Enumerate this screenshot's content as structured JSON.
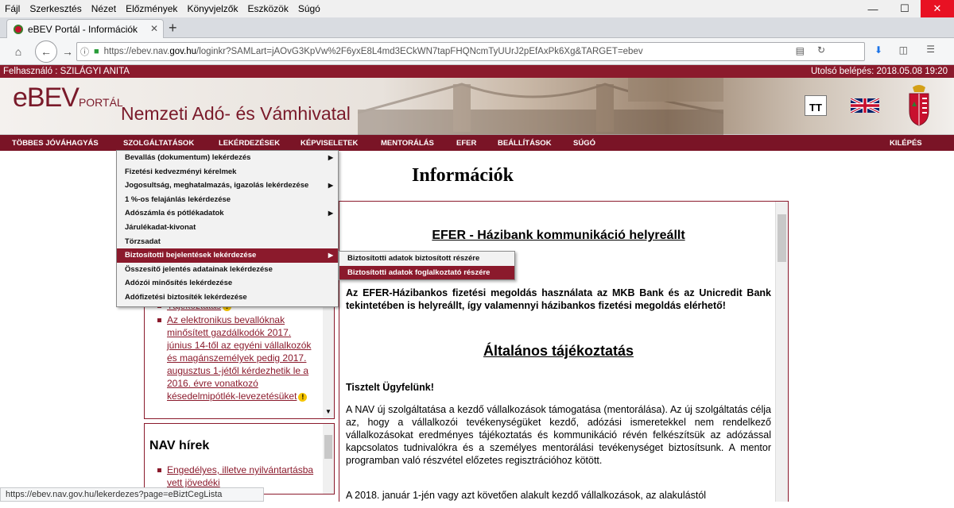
{
  "browser": {
    "menu": [
      "Fájl",
      "Szerkesztés",
      "Nézet",
      "Előzmények",
      "Könyvjelzők",
      "Eszközök",
      "Súgó"
    ],
    "tab_title": "eBEV Portál - Információk",
    "url_prefix": "https://ebev.nav.",
    "url_domain": "gov.hu",
    "url_rest": "/loginkr?SAMLart=jAOvG3KpVw%2F6yxE8L4md3ECkWN7tapFHQNcmTyUUrJ2pEfAxPk6Xg&TARGET=ebev",
    "status_url": "https://ebev.nav.gov.hu/lekerdezes?page=eBiztCegLista"
  },
  "header": {
    "user_label": "Felhasználó : SZILÁGYI ANITA",
    "last_login": "Utolsó belépés: 2018.05.08 19:20",
    "logo_main": "eBEV",
    "logo_small": "PORTÁL",
    "brand": "Nemzeti Adó- és Vámhivatal",
    "font_size_button": "TT"
  },
  "main_menu": [
    {
      "label": "TÖBBES JÓVÁHAGYÁS"
    },
    {
      "label": "SZOLGÁLTATÁSOK"
    },
    {
      "label": "LEKÉRDEZÉSEK"
    },
    {
      "label": "KÉPVISELETEK"
    },
    {
      "label": "MENTORÁLÁS"
    },
    {
      "label": "EFER"
    },
    {
      "label": "BEÁLLÍTÁSOK"
    },
    {
      "label": "SÚGÓ"
    },
    {
      "label": "KILÉPÉS"
    }
  ],
  "dropdown": {
    "items": [
      {
        "label": "Bevallás (dokumentum) lekérdezés",
        "has_sub": true
      },
      {
        "label": "Fizetési kedvezményi kérelmek",
        "has_sub": false
      },
      {
        "label": "Jogosultság, meghatalmazás, igazolás lekérdezése",
        "has_sub": true
      },
      {
        "label": "1 %-os felajánlás lekérdezése",
        "has_sub": false
      },
      {
        "label": "Adószámla és pótlékadatok",
        "has_sub": true
      },
      {
        "label": "Járulékadat-kivonat",
        "has_sub": false
      },
      {
        "label": "Törzsadat",
        "has_sub": false
      },
      {
        "label": "Biztosítotti bejelentések lekérdezése",
        "has_sub": true,
        "selected": true
      },
      {
        "label": "Összesítő jelentés adatainak lekérdezése",
        "has_sub": false
      },
      {
        "label": "Adózói minősítés lekérdezése",
        "has_sub": false
      },
      {
        "label": "Adófizetési biztosíték lekérdezése",
        "has_sub": false
      }
    ],
    "submenu": [
      {
        "label": "Biztosítotti adatok biztosított részére"
      },
      {
        "label": "Biztosítotti adatok foglalkoztató részére",
        "selected": true
      }
    ]
  },
  "page": {
    "title": "Információk",
    "left_items": [
      {
        "text": "Tájékoztatás"
      },
      {
        "text": "Az elektronikus bevallóknak minősített gazdálkodók 2017. június 14-től az egyéni vállalkozók és magánszemélyek pedig 2017. augusztus 1-jétől kérdezhetik le a 2016. évre vonatkozó késedelmipótlék-levezetésüket"
      }
    ],
    "nav_hirek_title": "NAV hírek",
    "nav_hirek_item": "Engedélyes, illetve nyilvántartásba vett jövedéki",
    "efer_heading": "EFER - Házibank kommunikáció helyreállt",
    "efer_text": "Az EFER-Házibankos fizetési megoldás használata az MKB Bank és az Unicredit Bank tekintetében is helyreállt, így valamennyi házibankos fizetési megoldás elérhető!",
    "general_heading": "Általános tájékoztatás",
    "greeting": "Tisztelt Ügyfelünk!",
    "para1": "A NAV új szolgáltatása a kezdő vállalkozások támogatása (mentorálása). Az új szolgáltatás célja az, hogy a vállalkozói tevékenységüket kezdő, adózási ismeretekkel nem rendelkező vállalkozásokat eredményes tájékoztatás és kommunikáció révén felkészítsük az adózással kapcsolatos tudnivalókra és a személyes mentorálási tevékenységet biztosítsunk. A mentor programban való részvétel előzetes regisztrációhoz kötött.",
    "para2": "A 2018. január 1-jén vagy azt követően alakult kezdő vállalkozások, az alakulástól"
  },
  "colors": {
    "accent": "#8b1a2c",
    "menu_bg": "#7a1426",
    "selected": "#8b1a2c"
  }
}
